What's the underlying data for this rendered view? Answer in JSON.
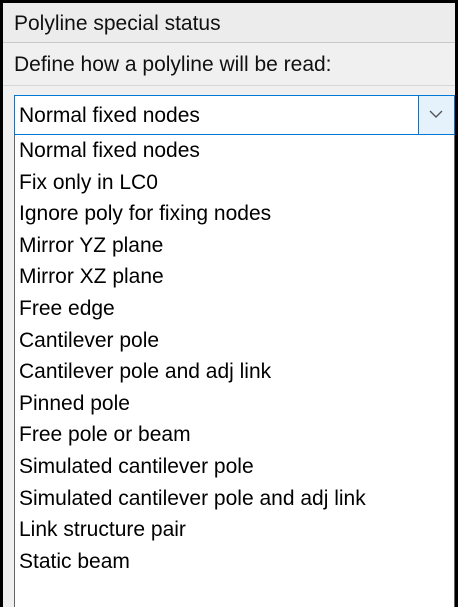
{
  "panel": {
    "title": "Polyline special status",
    "prompt": "Define how a polyline will be read:"
  },
  "dropdown": {
    "selected": "Normal fixed nodes",
    "arrow_icon": "chevron-down-icon",
    "options": [
      "Normal fixed nodes",
      "Fix only in LC0",
      "Ignore poly for fixing nodes",
      "Mirror YZ plane",
      "Mirror XZ plane",
      "Free edge",
      "Cantilever pole",
      "Cantilever pole and adj link",
      "Pinned pole",
      "Free pole or beam",
      "Simulated cantilever pole",
      "Simulated cantilever pole and adj link",
      "Link structure pair",
      "Static beam"
    ]
  },
  "colors": {
    "focus_border": "#0078d7",
    "arrow_background": "#e5f1fb",
    "panel_background": "#f0f0f0",
    "list_background": "#ffffff"
  }
}
